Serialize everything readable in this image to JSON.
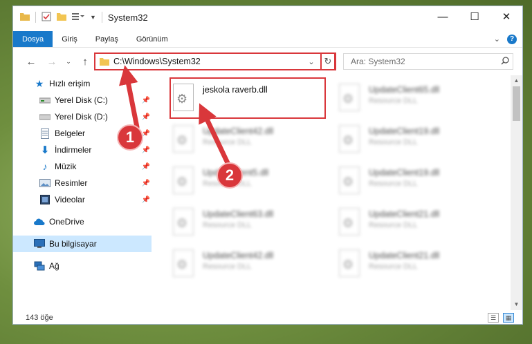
{
  "window": {
    "title": "System32"
  },
  "controls": {
    "minimize": "—",
    "maximize": "☐",
    "close": "✕"
  },
  "ribbon": {
    "tabs": [
      {
        "label": "Dosya",
        "active": true
      },
      {
        "label": "Giriş"
      },
      {
        "label": "Paylaş"
      },
      {
        "label": "Görünüm"
      }
    ]
  },
  "nav": {
    "address": "C:\\Windows\\System32",
    "search_placeholder": "Ara: System32"
  },
  "sidebar": {
    "items": [
      {
        "label": "Hızlı erişim",
        "icon": "star-icon"
      },
      {
        "label": "Yerel Disk (C:)",
        "icon": "drive-icon",
        "pinned": true
      },
      {
        "label": "Yerel Disk (D:)",
        "icon": "drive-icon",
        "pinned": true
      },
      {
        "label": "Belgeler",
        "icon": "document-icon",
        "pinned": true
      },
      {
        "label": "İndirmeler",
        "icon": "download-icon",
        "pinned": true
      },
      {
        "label": "Müzik",
        "icon": "music-icon",
        "pinned": true
      },
      {
        "label": "Resimler",
        "icon": "picture-icon",
        "pinned": true
      },
      {
        "label": "Videolar",
        "icon": "video-icon",
        "pinned": true
      },
      {
        "label": "OneDrive",
        "icon": "cloud-icon"
      },
      {
        "label": "Bu bilgisayar",
        "icon": "computer-icon",
        "selected": true
      },
      {
        "label": "Ağ",
        "icon": "network-icon"
      }
    ]
  },
  "files": [
    {
      "name": "jeskola raverb.dll",
      "type": ""
    },
    {
      "name": "UpdateClient65.dll",
      "type": "Resource DLL"
    },
    {
      "name": "UpdateClient42.dll",
      "type": "Resource DLL"
    },
    {
      "name": "UpdateClient19.dll",
      "type": "Resource DLL"
    },
    {
      "name": "UpdateClient5.dll",
      "type": "Resource DLL"
    },
    {
      "name": "UpdateClient19.dll",
      "type": "Resource DLL"
    },
    {
      "name": "UpdateClient63.dll",
      "type": "Resource DLL"
    },
    {
      "name": "UpdateClient21.dll",
      "type": "Resource DLL"
    },
    {
      "name": "UpdateClient42.dll",
      "type": "Resource DLL"
    },
    {
      "name": "UpdateClient21.dll",
      "type": "Resource DLL"
    }
  ],
  "status": {
    "count": "143 öğe"
  },
  "annotations": {
    "badge1": "1",
    "badge2": "2"
  },
  "colors": {
    "accent": "#1979ca",
    "highlight": "#d9373b",
    "selected": "#cce8ff"
  }
}
